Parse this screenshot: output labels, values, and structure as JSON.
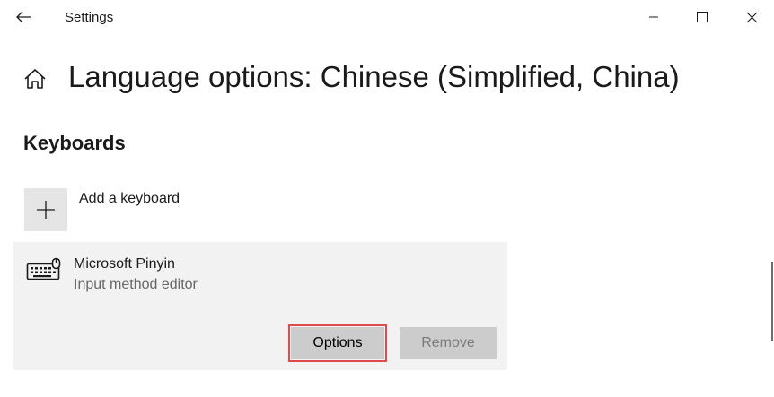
{
  "window": {
    "app_title": "Settings",
    "controls": {
      "minimize": "minimize-icon",
      "maximize": "maximize-icon",
      "close": "close-icon"
    }
  },
  "header": {
    "page_title": "Language options: Chinese (Simplified, China)"
  },
  "keyboards": {
    "section_title": "Keyboards",
    "add_label": "Add a keyboard",
    "items": [
      {
        "name": "Microsoft Pinyin",
        "description": "Input method editor",
        "icon": "keyboard-icon",
        "options_label": "Options",
        "remove_label": "Remove",
        "remove_enabled": false
      }
    ]
  },
  "colors": {
    "panel_bg": "#f2f2f2",
    "button_bg": "#cccccc",
    "highlight_border": "#e04a4a",
    "disabled_text": "#7a7a7a"
  }
}
